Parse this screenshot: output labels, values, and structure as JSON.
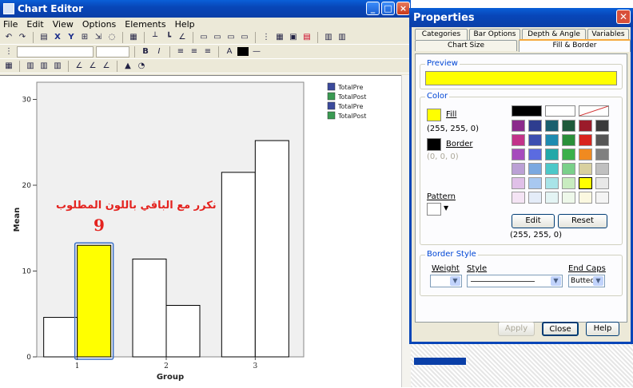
{
  "chart_editor": {
    "title": "Chart Editor",
    "menu": [
      "File",
      "Edit",
      "View",
      "Options",
      "Elements",
      "Help"
    ]
  },
  "chart_data": {
    "type": "bar",
    "categories": [
      "1",
      "2",
      "3"
    ],
    "series": [
      {
        "name": "TotalPre",
        "values": [
          4.6,
          11.4,
          21.5
        ]
      },
      {
        "name": "TotalPost",
        "values": [
          13.0,
          6.0,
          25.2
        ]
      }
    ],
    "legend_entries": [
      "TotalPre",
      "TotalPost",
      "TotalPre",
      "TotalPost"
    ],
    "legend_colors": [
      "#3b4a9c",
      "#3a9a52",
      "#3b4a9c",
      "#3a9a52"
    ],
    "xlabel": "Group",
    "ylabel": "Mean",
    "ylim": [
      0,
      32
    ],
    "yticks": [
      0,
      10,
      20,
      30
    ],
    "selected_bar_color": "#ffff00",
    "bar_color": "#ffffff",
    "plot_background": "#f0f0f0",
    "legend_placement": "top-right",
    "grid": false
  },
  "annotation": {
    "arabic_text": "نكرر مع الباقي باللون المطلوب",
    "number": "9",
    "color": "#e4231f"
  },
  "properties": {
    "title": "Properties",
    "tabs_row1": [
      "Categories",
      "Bar Options",
      "Depth & Angle",
      "Variables"
    ],
    "tabs_row2": [
      "Chart Size",
      "Fill & Border"
    ],
    "active_tab": "Fill & Border",
    "preview_label": "Preview",
    "preview_color": "#ffff00",
    "color_label": "Color",
    "fill_label": "Fill",
    "fill_value": "(255, 255, 0)",
    "border_label": "Border",
    "border_value": "(0, 0, 0)",
    "pattern_label": "Pattern",
    "edit_button": "Edit",
    "reset_button": "Reset",
    "selected_value": "(255, 255, 0)",
    "border_style_label": "Border Style",
    "weight_label": "Weight",
    "style_label": "Style",
    "end_caps_label": "End Caps",
    "end_caps_value": "Butted",
    "apply_button": "Apply",
    "close_button": "Close",
    "help_button": "Help",
    "palette": [
      [
        "#000000",
        "#ffffff",
        "none"
      ],
      [
        "#8b2a8b",
        "#2e3d8f",
        "#1a5f6e",
        "#1e5a3a",
        "#9b1b2a",
        "#3a3a3a"
      ],
      [
        "#c2338a",
        "#3d4fb0",
        "#1e8bb0",
        "#2a8f3a",
        "#d8241e",
        "#555555"
      ],
      [
        "#a64bbd",
        "#5b6be0",
        "#22a8a8",
        "#3ab04a",
        "#f08a20",
        "#808080"
      ],
      [
        "#bba0d5",
        "#7aa8e0",
        "#4cc8c8",
        "#7ad08a",
        "#d8d0a0",
        "#c0c0c0"
      ],
      [
        "#e0c0e8",
        "#a8c8f0",
        "#a8e4e8",
        "#c8ecc0",
        "#ffff00",
        "#e8e8e8"
      ],
      [
        "#f4e4f4",
        "#e4ecf8",
        "#e4f4f4",
        "#eef8ea",
        "#fbf8e0",
        "#f4f4f4"
      ]
    ]
  }
}
